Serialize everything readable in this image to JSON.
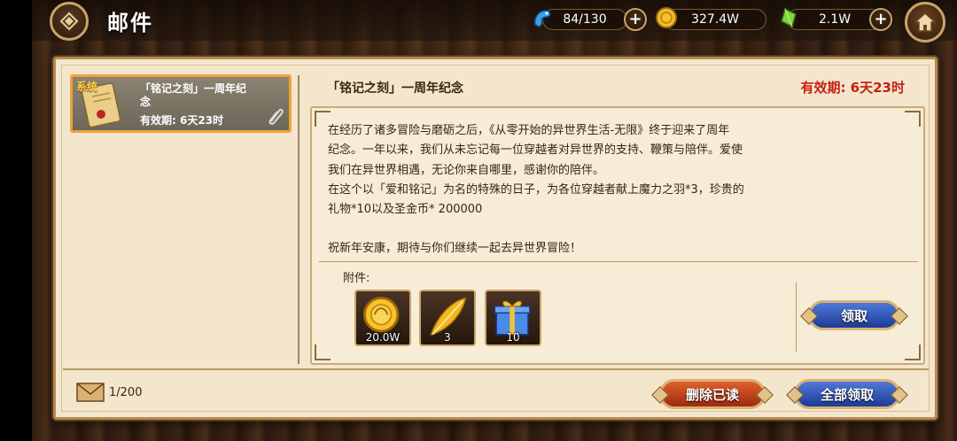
{
  "header": {
    "title": "邮件",
    "resources": [
      {
        "icon": "blue-dragon-icon",
        "value": "84/130"
      },
      {
        "icon": "gold-coin-icon",
        "value": "327.4W"
      },
      {
        "icon": "green-crystal-icon",
        "value": "2.1W"
      }
    ]
  },
  "mail_list": {
    "items": [
      {
        "tag": "系统",
        "title": "「铭记之刻」一周年纪念",
        "expiry": "有效期:    6天23时"
      }
    ]
  },
  "detail": {
    "title": "「铭记之刻」一周年纪念",
    "expiry": "有效期:  6天23时",
    "body": [
      "在经历了诸多冒险与磨砺之后，《从零开始的异世界生活-无限》终于迎来了周年",
      "纪念。一年以来，我们从未忘记每一位穿越者对异世界的支持、鞭策与陪伴。爱使",
      "我们在异世界相遇，无论你来自哪里，感谢你的陪伴。",
      "在这个以「爱和铭记」为名的特殊的日子，为各位穿越者献上魔力之羽*3，珍贵的",
      "礼物*10以及圣金币* 200000",
      "",
      "祝新年安康，期待与你们继续一起去异世界冒险！"
    ],
    "attachments_label": "附件:",
    "attachments": [
      {
        "icon": "gold-coin-icon",
        "count": "20.0W"
      },
      {
        "icon": "magic-feather-icon",
        "count": "3"
      },
      {
        "icon": "gift-box-icon",
        "count": "10"
      }
    ],
    "claim_label": "领取"
  },
  "footer": {
    "mail_count": "1/200",
    "delete_read_label": "删除已读",
    "claim_all_label": "全部领取"
  },
  "colors": {
    "expiry_red": "#c52014",
    "panel_bg": "#f3e6cc",
    "selected_border": "#f0a23a"
  }
}
